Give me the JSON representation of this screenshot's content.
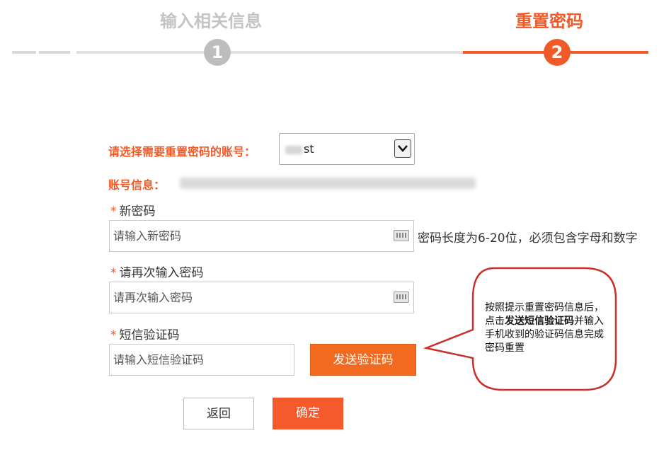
{
  "stepper": {
    "step1": {
      "title": "输入相关信息",
      "number": "1"
    },
    "step2": {
      "title": "重置密码",
      "number": "2"
    }
  },
  "form": {
    "account_label": "请选择需要重置密码的账号：",
    "account_value": "st",
    "account_info_label": "账号信息：",
    "new_password": {
      "label": "新密码",
      "placeholder": "请输入新密码",
      "hint": "密码长度为6-20位，必须包含字母和数字"
    },
    "confirm_password": {
      "label": "请再次输入密码",
      "placeholder": "请再次输入密码"
    },
    "sms_code": {
      "label": "短信验证码",
      "placeholder": "请输入短信验证码",
      "send_button": "发送验证码"
    },
    "required_mark": "*",
    "back_button": "返回",
    "confirm_button": "确定"
  },
  "callout": {
    "part1": "按照提示重置密码信息后，点击",
    "bold": "发送短信验证码",
    "part2": "并输入手机收到的验证码信息完成密码重置"
  },
  "colors": {
    "accent": "#f05a28",
    "inactive": "#bdbdbd",
    "callout_border": "#c9302c"
  }
}
